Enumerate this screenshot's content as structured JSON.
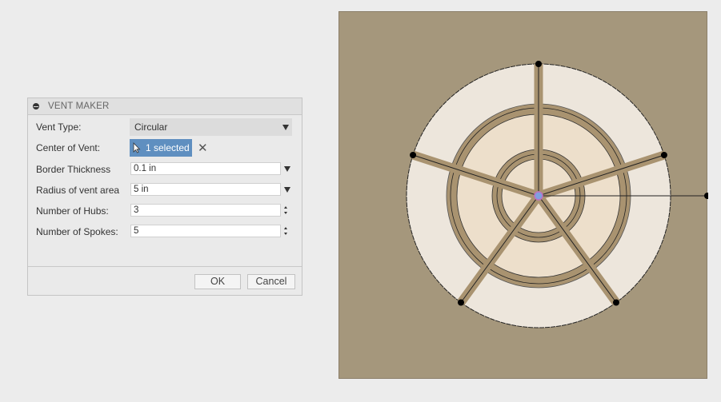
{
  "dialog": {
    "title": "VENT MAKER",
    "fields": [
      {
        "label": "Vent Type:",
        "type": "dropdown",
        "value": "Circular"
      },
      {
        "label": "Center of Vent:",
        "type": "selection",
        "value": "1 selected"
      },
      {
        "label": "Border Thickness",
        "type": "value-input",
        "value": "0.1 in"
      },
      {
        "label": "Radius of vent area",
        "type": "value-input",
        "value": "5 in"
      },
      {
        "label": "Number of Hubs:",
        "type": "spinner",
        "value": "3"
      },
      {
        "label": "Number of Spokes:",
        "type": "spinner",
        "value": "5"
      }
    ],
    "ok_label": "OK",
    "cancel_label": "Cancel"
  },
  "icons": {
    "collapse": "minus-circle-icon",
    "select_cursor": "arrow-cursor-icon",
    "clear": "close-icon",
    "dropdown": "triangle-down-icon",
    "spinner": "spinner-arrows-icon"
  },
  "colors": {
    "selection_chip": "#5f8fc0",
    "canvas_background": "#a5977c",
    "outer_band": "#ede6dc",
    "inner_cells": "#eddfcb",
    "frame": "#a99370",
    "center_point": "#7fa0e0"
  },
  "drawing": {
    "hubs": 3,
    "spokes": 5
  }
}
